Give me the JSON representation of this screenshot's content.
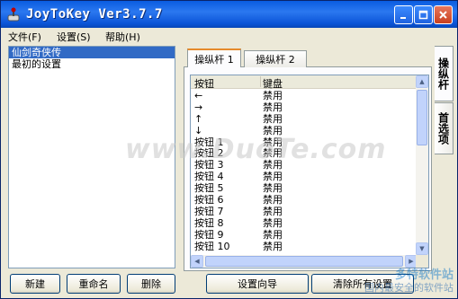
{
  "window": {
    "title": "JoyToKey Ver3.7.7"
  },
  "menu": [
    {
      "label": "文件(F)"
    },
    {
      "label": "设置(S)"
    },
    {
      "label": "帮助(H)"
    }
  ],
  "profiles": {
    "items": [
      "仙剑奇侠传",
      "最初的设置"
    ],
    "selected_index": 0
  },
  "profile_buttons": {
    "new": "新建",
    "rename": "重命名",
    "delete": "删除"
  },
  "tabs": [
    {
      "label": "操纵杆 1",
      "active": true
    },
    {
      "label": "操纵杆 2",
      "active": false
    }
  ],
  "side_tabs": {
    "joystick": "操纵杆",
    "preferences": "首选项"
  },
  "mapping_table": {
    "headers": {
      "button": "按钮",
      "keyboard": "键盘"
    },
    "rows": [
      {
        "button": "←",
        "key": "禁用"
      },
      {
        "button": "→",
        "key": "禁用"
      },
      {
        "button": "↑",
        "key": "禁用"
      },
      {
        "button": "↓",
        "key": "禁用"
      },
      {
        "button": "按钮 1",
        "key": "禁用"
      },
      {
        "button": "按钮 2",
        "key": "禁用"
      },
      {
        "button": "按钮 3",
        "key": "禁用"
      },
      {
        "button": "按钮 4",
        "key": "禁用"
      },
      {
        "button": "按钮 5",
        "key": "禁用"
      },
      {
        "button": "按钮 6",
        "key": "禁用"
      },
      {
        "button": "按钮 7",
        "key": "禁用"
      },
      {
        "button": "按钮 8",
        "key": "禁用"
      },
      {
        "button": "按钮 9",
        "key": "禁用"
      },
      {
        "button": "按钮 10",
        "key": "禁用"
      }
    ]
  },
  "bottom_buttons": {
    "wizard": "设置向导",
    "clear_all": "清除所有设置"
  },
  "watermarks": {
    "center": "www.DuoTe.com",
    "logo_line1": "多特软件站",
    "logo_line2": "国内最安全的软件站"
  },
  "colors": {
    "title_bar": "#0a53d6",
    "selection": "#316ac5",
    "active_tab_accent": "#e68b2c"
  }
}
